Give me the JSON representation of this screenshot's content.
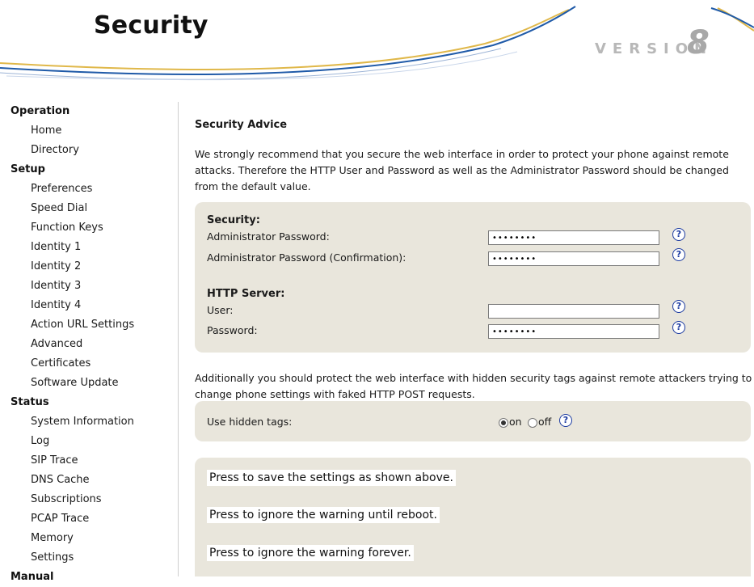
{
  "header": {
    "title": "Security",
    "version_word": "VERSION",
    "version_number": "8"
  },
  "sidebar": {
    "groups": [
      {
        "label": "Operation",
        "items": [
          "Home",
          "Directory"
        ]
      },
      {
        "label": "Setup",
        "items": [
          "Preferences",
          "Speed Dial",
          "Function Keys",
          "Identity 1",
          "Identity 2",
          "Identity 3",
          "Identity 4",
          "Action URL Settings",
          "Advanced",
          "Certificates",
          "Software Update"
        ]
      },
      {
        "label": "Status",
        "items": [
          "System Information",
          "Log",
          "SIP Trace",
          "DNS Cache",
          "Subscriptions",
          "PCAP Trace",
          "Memory",
          "Settings"
        ]
      },
      {
        "label": "Manual",
        "items": []
      }
    ]
  },
  "main": {
    "advice_heading": "Security Advice",
    "advice_text": "We strongly recommend that you secure the web interface in order to protect your phone against remote attacks. Therefore the HTTP User and Password as well as the Administrator Password should be changed from the default value.",
    "security": {
      "heading": "Security:",
      "admin_password_label": "Administrator Password:",
      "admin_password_value": "••••••••",
      "admin_confirm_label": "Administrator Password (Confirmation):",
      "admin_confirm_value": "••••••••"
    },
    "http_server": {
      "heading": "HTTP Server:",
      "user_label": "User:",
      "user_value": "",
      "password_label": "Password:",
      "password_value": "••••••••"
    },
    "help_glyph": "?",
    "tags_note": "Additionally you should protect the web interface with hidden security tags against remote attackers trying to change phone settings with faked HTTP POST requests.",
    "hidden_tags": {
      "label": "Use hidden tags:",
      "on_label": "on",
      "off_label": "off",
      "selected": "on"
    },
    "buttons": {
      "save": "Press to save the settings as shown above.",
      "ignore_reboot": "Press to ignore the warning until reboot.",
      "ignore_forever": "Press to ignore the warning forever."
    }
  },
  "colors": {
    "panel_bg": "#e9e6dc",
    "help_icon": "#1b3aa0",
    "swoosh_blue": "#1f5aa8",
    "swoosh_gold": "#e0b84a"
  }
}
